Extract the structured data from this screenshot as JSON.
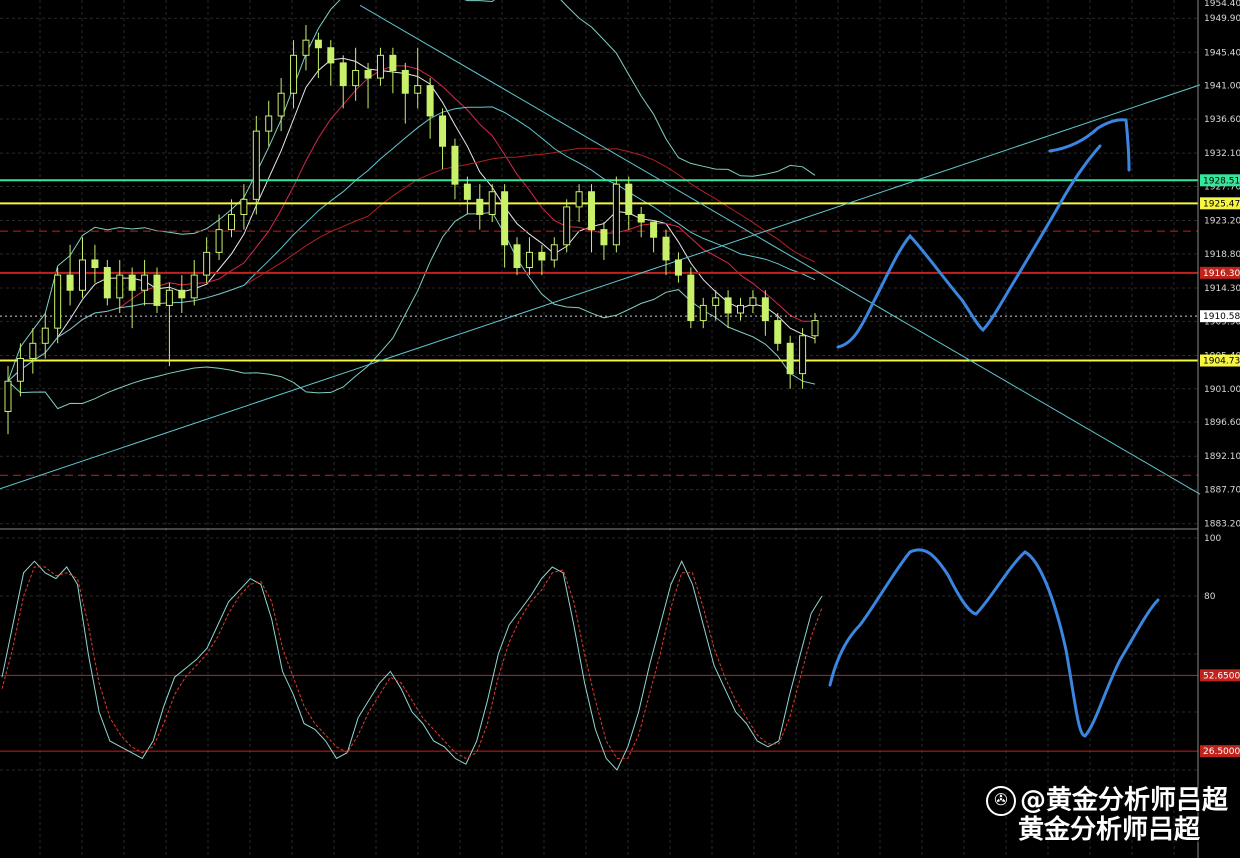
{
  "chart_data": [
    {
      "type": "candlestick",
      "panel": "price",
      "y_ticks": [
        "1949.90",
        "1945.40",
        "1941.00",
        "1936.60",
        "1932.10",
        "1927.70",
        "1923.20",
        "1918.80",
        "1914.30",
        "1909.90",
        "1905.40",
        "1901.00",
        "1896.60",
        "1892.10",
        "1887.70",
        "1883.20"
      ],
      "y_tick_values": [
        1949.9,
        1945.4,
        1941.0,
        1936.6,
        1932.1,
        1927.7,
        1923.2,
        1918.8,
        1914.3,
        1909.9,
        1905.4,
        1901.0,
        1896.6,
        1892.1,
        1887.7,
        1883.2
      ],
      "top_partial_label": "1954.40",
      "ylim": [
        1882.5,
        1952.3
      ],
      "price_lines": [
        {
          "value": 1928.51,
          "label": "1928.51",
          "color": "#35e59a",
          "style": "solid",
          "tag_bg": "#35e59a",
          "tag_fg": "#000000"
        },
        {
          "value": 1925.47,
          "label": "1925.47",
          "color": "#f5f542",
          "style": "solid",
          "tag_bg": "#f5f542",
          "tag_fg": "#000000"
        },
        {
          "value": 1916.3,
          "label": "1916.30",
          "color": "#c0231c",
          "style": "solid",
          "tag_bg": "#c0231c",
          "tag_fg": "#ffffff"
        },
        {
          "value": 1910.58,
          "label": "1910.58",
          "color": "#cfcfcf",
          "style": "dotted",
          "tag_bg": "#ffffff",
          "tag_fg": "#000000"
        },
        {
          "value": 1904.73,
          "label": "1904.73",
          "color": "#f5f542",
          "style": "solid",
          "tag_bg": "#f5f542",
          "tag_fg": "#000000"
        },
        {
          "value": 1921.8,
          "label": "",
          "color": "#c0231c",
          "style": "dashed"
        },
        {
          "value": 1889.6,
          "label": "",
          "color": "#c0231c",
          "style": "dashed"
        }
      ],
      "trend_lines": [
        {
          "from": [
            0,
            1887.8
          ],
          "to": [
            1200,
            1941.1
          ],
          "color": "#5fc8d0"
        },
        {
          "from": [
            360,
            1951.6
          ],
          "to": [
            1200,
            1887.1
          ],
          "color": "#5fc8d0"
        }
      ],
      "candles": [
        [
          1898,
          1902,
          1895,
          1904
        ],
        [
          1902,
          1905,
          1900,
          1907
        ],
        [
          1905,
          1907,
          1903,
          1909
        ],
        [
          1907,
          1909,
          1905,
          1911
        ],
        [
          1909,
          1916,
          1907,
          1917
        ],
        [
          1916,
          1914,
          1912,
          1920
        ],
        [
          1914,
          1918,
          1913,
          1921
        ],
        [
          1918,
          1917,
          1915,
          1920
        ],
        [
          1917,
          1913,
          1912,
          1918
        ],
        [
          1913,
          1916,
          1911,
          1918
        ],
        [
          1916,
          1914,
          1909,
          1917
        ],
        [
          1914,
          1916,
          1912,
          1918
        ],
        [
          1916,
          1912,
          1911,
          1917
        ],
        [
          1912,
          1914,
          1904,
          1915
        ],
        [
          1914,
          1913,
          1911,
          1916
        ],
        [
          1913,
          1916,
          1912,
          1918
        ],
        [
          1916,
          1919,
          1915,
          1921
        ],
        [
          1919,
          1922,
          1918,
          1924
        ],
        [
          1922,
          1924,
          1921,
          1926
        ],
        [
          1924,
          1926,
          1922,
          1928
        ],
        [
          1926,
          1935,
          1924,
          1937
        ],
        [
          1935,
          1937,
          1933,
          1939
        ],
        [
          1937,
          1940,
          1935,
          1942
        ],
        [
          1940,
          1945,
          1938,
          1947
        ],
        [
          1945,
          1947,
          1943,
          1949
        ],
        [
          1947,
          1946,
          1942,
          1948
        ],
        [
          1946,
          1944,
          1941,
          1947
        ],
        [
          1944,
          1941,
          1938,
          1945
        ],
        [
          1941,
          1943,
          1939,
          1946
        ],
        [
          1943,
          1942,
          1938,
          1944
        ],
        [
          1942,
          1945,
          1941,
          1946
        ],
        [
          1945,
          1943,
          1940,
          1946
        ],
        [
          1943,
          1940,
          1936,
          1944
        ],
        [
          1940,
          1941,
          1938,
          1946
        ],
        [
          1941,
          1937,
          1934,
          1942
        ],
        [
          1937,
          1933,
          1930,
          1938
        ],
        [
          1933,
          1928,
          1926,
          1934
        ],
        [
          1928,
          1926,
          1924,
          1929
        ],
        [
          1926,
          1924,
          1922,
          1928
        ],
        [
          1924,
          1927,
          1923,
          1928
        ],
        [
          1927,
          1920,
          1917,
          1928
        ],
        [
          1920,
          1917,
          1916,
          1921
        ],
        [
          1917,
          1919,
          1916,
          1921
        ],
        [
          1919,
          1918,
          1916,
          1920
        ],
        [
          1918,
          1920,
          1917,
          1921
        ],
        [
          1920,
          1925,
          1919,
          1926
        ],
        [
          1925,
          1927,
          1923,
          1928
        ],
        [
          1927,
          1922,
          1919,
          1928
        ],
        [
          1922,
          1920,
          1918,
          1923
        ],
        [
          1920,
          1928,
          1919,
          1929
        ],
        [
          1928,
          1924,
          1922,
          1929
        ],
        [
          1924,
          1923,
          1921,
          1925
        ],
        [
          1923,
          1921,
          1919,
          1922
        ],
        [
          1921,
          1918,
          1916,
          1922
        ],
        [
          1918,
          1916,
          1915,
          1919
        ],
        [
          1916,
          1910,
          1909,
          1917
        ],
        [
          1910,
          1912,
          1909,
          1913
        ],
        [
          1912,
          1913,
          1910,
          1914
        ],
        [
          1913,
          1911,
          1909,
          1914
        ],
        [
          1911,
          1912,
          1910,
          1913
        ],
        [
          1912,
          1913,
          1911,
          1914
        ],
        [
          1913,
          1910,
          1908,
          1914
        ],
        [
          1910,
          1907,
          1906,
          1911
        ],
        [
          1907,
          1903,
          1901,
          1908
        ],
        [
          1903,
          1908,
          1901,
          1909
        ],
        [
          1908,
          1910,
          1907,
          1911
        ]
      ]
    },
    {
      "type": "line",
      "panel": "oscillator",
      "y_ticks": [
        "100",
        "80",
        "52.6500",
        "26.5000"
      ],
      "y_tick_values": [
        100,
        80,
        52.65,
        26.5
      ],
      "ylim": [
        0,
        100
      ],
      "levels": [
        {
          "value": 52.65,
          "label": "52.6500",
          "color": "#c0231c"
        },
        {
          "value": 26.5,
          "label": "26.5000",
          "color": "#c0231c"
        }
      ],
      "series": [
        {
          "color": "#8fd7d2",
          "style": "solid",
          "values": [
            52,
            70,
            88,
            92,
            88,
            86,
            90,
            84,
            60,
            40,
            30,
            28,
            26,
            24,
            30,
            42,
            52,
            55,
            58,
            62,
            70,
            78,
            82,
            86,
            84,
            72,
            54,
            46,
            36,
            34,
            30,
            24,
            26,
            38,
            44,
            50,
            54,
            48,
            40,
            36,
            30,
            28,
            24,
            22,
            30,
            44,
            60,
            70,
            75,
            80,
            86,
            90,
            88,
            70,
            50,
            34,
            24,
            20,
            28,
            40,
            56,
            70,
            84,
            92,
            84,
            70,
            56,
            48,
            40,
            36,
            30,
            28,
            30,
            46,
            60,
            74,
            80
          ]
        },
        {
          "color": "#e03b2f",
          "style": "dashed",
          "values": [
            48,
            62,
            80,
            90,
            90,
            87,
            88,
            86,
            70,
            50,
            38,
            32,
            28,
            26,
            28,
            36,
            46,
            52,
            56,
            60,
            66,
            74,
            80,
            84,
            85,
            78,
            62,
            52,
            42,
            36,
            32,
            28,
            26,
            32,
            40,
            46,
            52,
            50,
            44,
            38,
            34,
            30,
            26,
            24,
            26,
            36,
            52,
            64,
            72,
            78,
            82,
            88,
            89,
            78,
            60,
            44,
            30,
            24,
            24,
            32,
            46,
            60,
            76,
            88,
            88,
            76,
            62,
            52,
            44,
            38,
            32,
            29,
            29,
            38,
            52,
            66,
            76
          ]
        }
      ]
    }
  ],
  "projection_color": "#3a86e0"
}
